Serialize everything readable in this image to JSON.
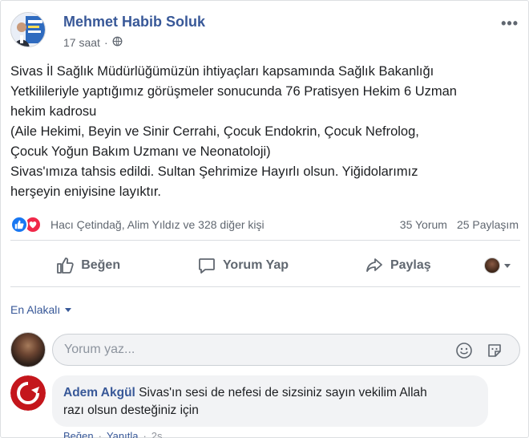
{
  "post": {
    "author": "Mehmet Habib Soluk",
    "time": "17 saat",
    "privacy_dot": "·",
    "more": "•••",
    "body_lines": [
      "Sivas İl Sağlık Müdürlüğümüzün ihtiyaçları kapsamında Sağlık Bakanlığı",
      "Yetkilileriyle yaptığımız görüşmeler sonucunda 76 Pratisyen Hekim 6 Uzman",
      "hekim kadrosu",
      "(Aile Hekimi, Beyin ve Sinir Cerrahi, Çocuk Endokrin, Çocuk Nefrolog,",
      "Çocuk Yoğun Bakım Uzmanı ve Neonatoloji)",
      "Sivas'ımıza tahsis edildi. Sultan Şehrimize Hayırlı olsun. Yiğidolarımız",
      "herşeyin eniyisine layıktır."
    ]
  },
  "reactions": {
    "names": "Hacı Çetindağ, Alim Yıldız ve 328 diğer kişi",
    "comments": "35 Yorum",
    "shares": "25 Paylaşım"
  },
  "actions": {
    "like": "Beğen",
    "comment": "Yorum Yap",
    "share": "Paylaş"
  },
  "sort": {
    "label": "En Alakalı"
  },
  "composer": {
    "placeholder": "Yorum yaz..."
  },
  "comments": [
    {
      "author": "Adem Akgül",
      "text_line1": "Sivas'ın sesi de nefesi de sizsiniz sayın vekilim Allah",
      "text_line2": "razı olsun desteğiniz için",
      "like": "Beğen",
      "separator": "·",
      "reply": "Yanıtla",
      "time": "2s"
    }
  ],
  "colors": {
    "link_blue": "#385898",
    "like_blue": "#1877f2",
    "love_red": "#f02849",
    "muted_text": "#606770"
  },
  "icons": [
    "globe-icon",
    "more-options-icon",
    "like-reaction-icon",
    "love-reaction-icon",
    "thumbs-up-icon",
    "comment-bubble-icon",
    "share-arrow-icon",
    "caret-down-icon",
    "smiley-icon",
    "sticker-icon"
  ]
}
